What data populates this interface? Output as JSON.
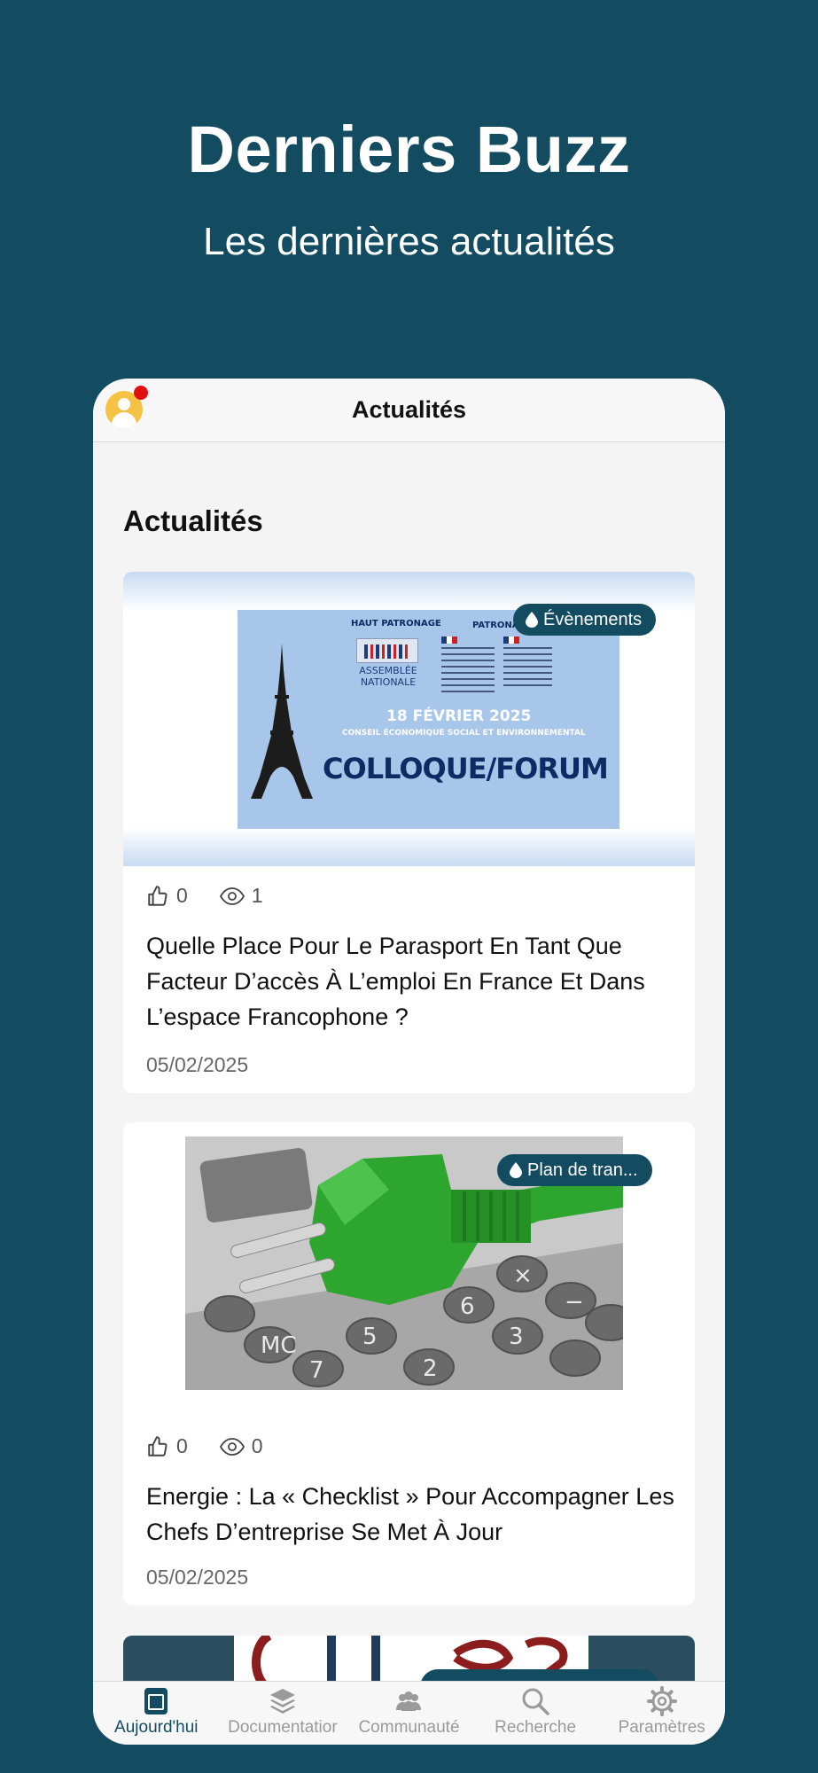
{
  "hero": {
    "title": "Derniers Buzz",
    "subtitle": "Les dernières actualités"
  },
  "navbar": {
    "title": "Actualités",
    "has_notification": true
  },
  "section": {
    "title": "Actualités"
  },
  "articles": [
    {
      "category": "Évènements",
      "likes": "0",
      "views": "1",
      "title": "Quelle Place Pour Le Parasport En Tant Que Facteur D’accès À L’emploi En France Et Dans L’espace Francophone ?",
      "date": "05/02/2025",
      "poster": {
        "haut_patronage": "HAUT PATRONAGE",
        "patronage": "PATRONAGE",
        "assemblee": "ASSEMBLÉE NATIONALE",
        "date": "18 FÉVRIER 2025",
        "venue": "CONSEIL ÉCONOMIQUE SOCIAL ET ENVIRONNEMENTAL",
        "event": "COLLOQUE/FORUM"
      }
    },
    {
      "category": "Plan de tran...",
      "likes": "0",
      "views": "0",
      "title": "Energie : La « Checklist » Pour Accompagner Les Chefs D’entreprise Se Met À Jour",
      "date": "05/02/2025"
    }
  ],
  "tabbar": [
    {
      "label": "Aujourd'hui",
      "icon": "today-icon",
      "active": true
    },
    {
      "label": "Documentatior",
      "icon": "layers-icon",
      "active": false
    },
    {
      "label": "Communauté",
      "icon": "community-icon",
      "active": false
    },
    {
      "label": "Recherche",
      "icon": "search-icon",
      "active": false
    },
    {
      "label": "Paramètres",
      "icon": "gear-icon",
      "active": false
    }
  ],
  "colors": {
    "background": "#134c60",
    "accent": "#134c60",
    "notification": "#e11010"
  }
}
